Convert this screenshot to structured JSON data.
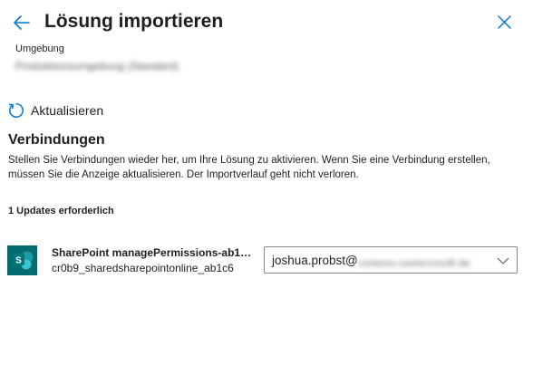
{
  "header": {
    "title": "Lösung importieren"
  },
  "environment": {
    "label": "Umgebung",
    "value": "Produktionsumgebung (Standard)"
  },
  "toolbar": {
    "refresh_label": "Aktualisieren"
  },
  "connections": {
    "title": "Verbindungen",
    "description": "Stellen Sie Verbindungen wieder her, um Ihre Lösung zu aktivieren. Wenn Sie eine Verbindung erstellen, müssen Sie die Anzeige aktualisieren. Der Importverlauf geht nicht verloren.",
    "updates_required": "1 Updates erforderlich",
    "items": [
      {
        "name": "SharePoint managePermissions-ab1c6...",
        "reference": "cr0b9_sharedsharepointonline_ab1c6",
        "icon": "sharepoint-icon",
        "selected_user": "joshua.probst@",
        "selected_domain": "contoso.onmicrosoft.de"
      }
    ]
  },
  "colors": {
    "accent": "#0078d4",
    "sharepoint_dark": "#036c70",
    "sharepoint_mid": "#1a9ba1",
    "sharepoint_light": "#37c6d0"
  }
}
